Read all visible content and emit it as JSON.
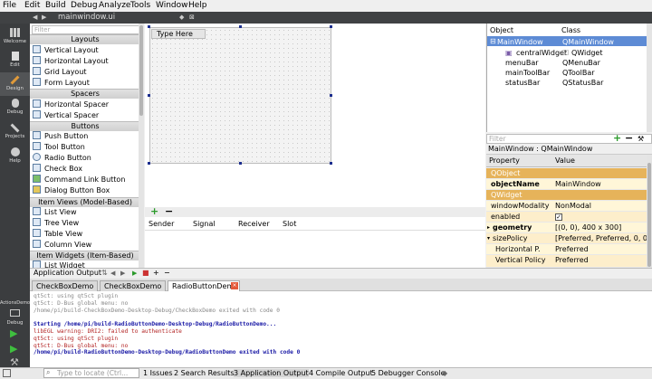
{
  "menu": [
    "File",
    "Edit",
    "Build",
    "Debug",
    "Analyze",
    "Tools",
    "Window",
    "Help"
  ],
  "document": {
    "filename": "mainwindow.ui"
  },
  "modes": [
    {
      "label": "Welcome",
      "icon": "grid-icon"
    },
    {
      "label": "Edit",
      "icon": "document-icon"
    },
    {
      "label": "Design",
      "icon": "pencil-icon"
    },
    {
      "label": "Debug",
      "icon": "bug-icon"
    },
    {
      "label": "Projects",
      "icon": "wrench-icon"
    },
    {
      "label": "Help",
      "icon": "question-icon"
    }
  ],
  "kit": {
    "project": "ActionsDemo",
    "mode": "Debug"
  },
  "widget_box": {
    "filter_placeholder": "Filter",
    "categories": {
      "layouts": "Layouts",
      "spacers": "Spacers",
      "buttons": "Buttons",
      "item_views": "Item Views (Model-Based)",
      "item_widgets": "Item Widgets (Item-Based)"
    },
    "layouts": [
      "Vertical Layout",
      "Horizontal Layout",
      "Grid Layout",
      "Form Layout"
    ],
    "spacers": [
      "Horizontal Spacer",
      "Vertical Spacer"
    ],
    "buttons": [
      "Push Button",
      "Tool Button",
      "Radio Button",
      "Check Box",
      "Command Link Button",
      "Dialog Button Box"
    ],
    "item_views": [
      "List View",
      "Tree View",
      "Table View",
      "Column View"
    ],
    "item_widgets": [
      "List Widget"
    ]
  },
  "form": {
    "menu_placeholder": "Type Here"
  },
  "signal_editor": {
    "columns": [
      "Sender",
      "Signal",
      "Receiver",
      "Slot"
    ]
  },
  "object_inspector": {
    "columns": [
      "Object",
      "Class"
    ],
    "rows": [
      {
        "object": "MainWindow",
        "class": "QMainWindow"
      },
      {
        "object": "centralWidget",
        "class": "QWidget"
      },
      {
        "object": "menuBar",
        "class": "QMenuBar"
      },
      {
        "object": "mainToolBar",
        "class": "QToolBar"
      },
      {
        "object": "statusBar",
        "class": "QStatusBar"
      }
    ]
  },
  "property_editor": {
    "filter_placeholder": "Filter",
    "class_label": "MainWindow : QMainWindow",
    "columns": [
      "Property",
      "Value"
    ],
    "rows": [
      {
        "name": "QObject",
        "value": "",
        "kind": "group"
      },
      {
        "name": "objectName",
        "value": "MainWindow",
        "kind": "bold"
      },
      {
        "name": "QWidget",
        "value": "",
        "kind": "group"
      },
      {
        "name": "windowModality",
        "value": "NonModal",
        "kind": "prop"
      },
      {
        "name": "enabled",
        "value": "",
        "kind": "check"
      },
      {
        "name": "geometry",
        "value": "[(0, 0), 400 x 300]",
        "kind": "bold"
      },
      {
        "name": "sizePolicy",
        "value": "[Preferred, Preferred, 0, 0]",
        "kind": "prop"
      },
      {
        "name": "Horizontal P.",
        "value": "Preferred",
        "kind": "sub"
      },
      {
        "name": "Vertical Policy",
        "value": "Preferred",
        "kind": "sub"
      }
    ]
  },
  "app_output": {
    "title": "Application Output",
    "tabs": [
      "CheckBoxDemo",
      "CheckBoxDemo",
      "RadioButtonDemo"
    ],
    "lines": [
      {
        "text": "qt5ct: using qt5ct plugin",
        "color": "#888888"
      },
      {
        "text": "qt5ct: D-Bus global menu: no",
        "color": "#888888"
      },
      {
        "text": "/home/pi/build-CheckBoxDemo-Desktop-Debug/CheckBoxDemo exited with code 0",
        "color": "#888888"
      },
      {
        "text": "",
        "color": "#000000"
      },
      {
        "text": "Starting /home/pi/build-RadioButtonDemo-Desktop-Debug/RadioButtonDemo...",
        "color": "#1a1aa6"
      },
      {
        "text": "libEGL warning: DRI2: failed to authenticate",
        "color": "#b22222"
      },
      {
        "text": "qt5ct: using qt5ct plugin",
        "color": "#b22222"
      },
      {
        "text": "qt5ct: D-Bus global menu: no",
        "color": "#b22222"
      },
      {
        "text": "/home/pi/build-RadioButtonDemo-Desktop-Debug/RadioButtonDemo exited with code 0",
        "color": "#1a1aa6"
      }
    ]
  },
  "status_bar": {
    "locate_placeholder": "Type to locate (Ctrl...",
    "panes": [
      "1 Issues",
      "2 Search Results",
      "3 Application Output",
      "4 Compile Output",
      "5 Debugger Console"
    ]
  },
  "colors": {
    "selection": "#5d8bd5",
    "group": "#e6b35a",
    "modebar": "#3b3d3f"
  }
}
